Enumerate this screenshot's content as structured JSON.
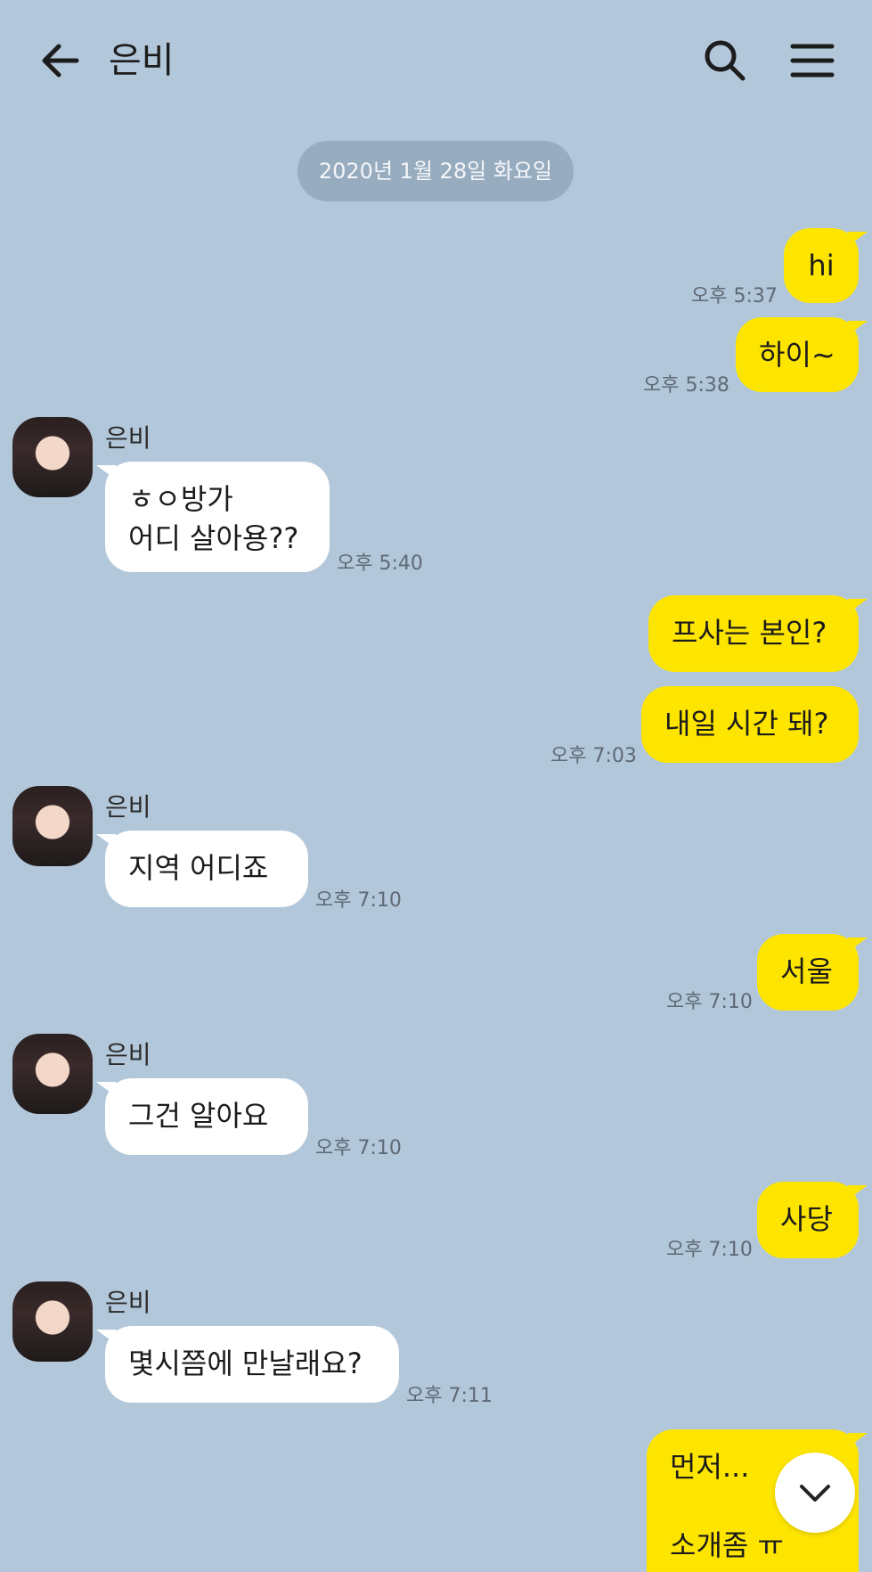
{
  "header": {
    "title": "은비",
    "back_icon": "arrow-left-icon",
    "search_icon": "search-icon",
    "menu_icon": "hamburger-menu-icon"
  },
  "date_divider": "2020년 1월 28일 화요일",
  "messages": [
    {
      "from": "me",
      "text": "hi",
      "time": "오후 5:37"
    },
    {
      "from": "me",
      "text": "하이~",
      "time": "오후 5:38"
    },
    {
      "from": "other",
      "sender": "은비",
      "text": "ㅎㅇ방가\n어디 살아용??",
      "time": "오후 5:40"
    },
    {
      "from": "me",
      "text": "프사는 본인?",
      "time": ""
    },
    {
      "from": "me",
      "text": "내일 시간 돼?",
      "time": "오후 7:03"
    },
    {
      "from": "other",
      "sender": "은비",
      "text": "지역 어디죠",
      "time": "오후 7:10"
    },
    {
      "from": "me",
      "text": "서울",
      "time": "오후 7:10"
    },
    {
      "from": "other",
      "sender": "은비",
      "text": "그건 알아요",
      "time": "오후 7:10"
    },
    {
      "from": "me",
      "text": "사당",
      "time": "오후 7:10"
    },
    {
      "from": "other",
      "sender": "은비",
      "text": "몇시쯤에 만날래요?",
      "time": "오후 7:11"
    },
    {
      "from": "me",
      "text": "먼저...\n\n소개좀 ㅠ",
      "time": ""
    }
  ],
  "scroll_down_icon": "chevron-down-icon",
  "colors": {
    "background": "#b2c7da",
    "my_bubble": "#fee500",
    "other_bubble": "#ffffff"
  }
}
